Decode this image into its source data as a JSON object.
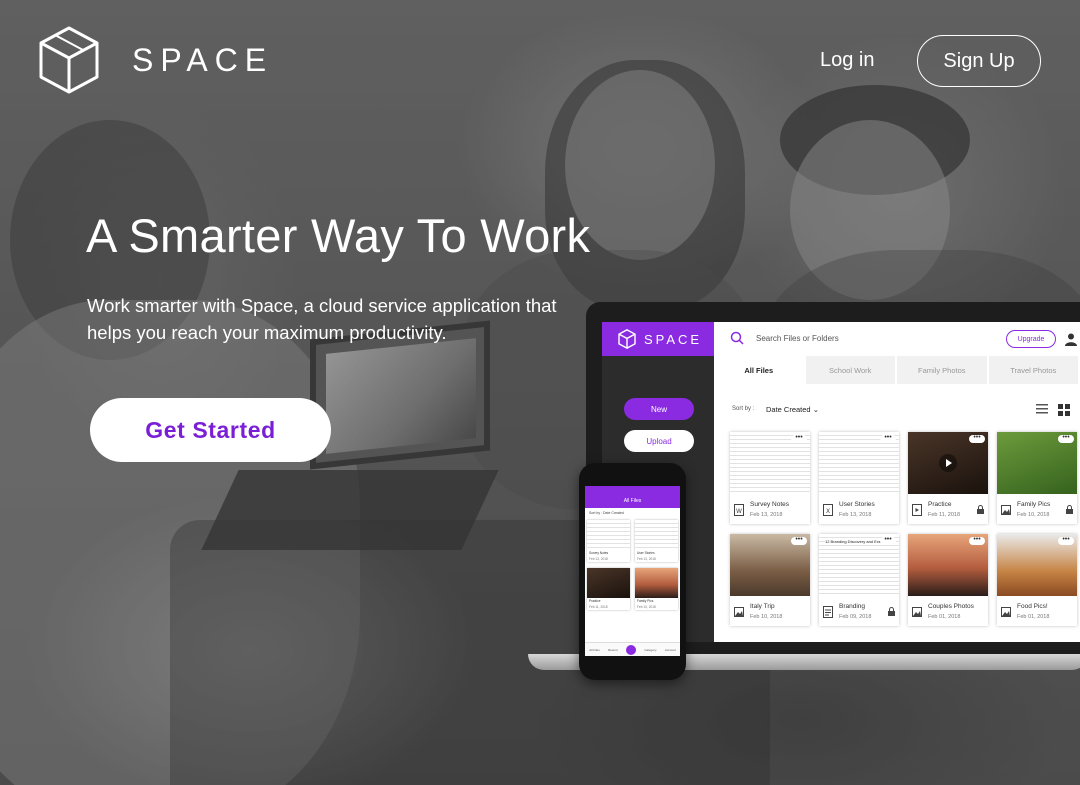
{
  "brand": {
    "name": "SPACE"
  },
  "nav": {
    "login_label": "Log in",
    "signup_label": "Sign Up"
  },
  "hero": {
    "title": "A Smarter Way To Work",
    "subtitle": "Work smarter with Space, a cloud service application that helps you reach your maximum productivity.",
    "cta_label": "Get Started"
  },
  "colors": {
    "accent": "#7a1fd6",
    "app_purple": "#8a2be2"
  },
  "app": {
    "brand": "SPACE",
    "search_placeholder": "Search Files or Folders",
    "upgrade_label": "Upgrade",
    "new_label": "New",
    "upload_label": "Upload",
    "tabs": [
      "All Files",
      "School Work",
      "Family Photos",
      "Travel Photos"
    ],
    "sort_label": "Sort by :",
    "sort_value": "Date Created",
    "files": [
      {
        "name": "Survey Notes",
        "date": "Feb 13, 2018",
        "kind": "doc",
        "locked": false
      },
      {
        "name": "User Stories",
        "date": "Feb 13, 2018",
        "kind": "doc",
        "locked": false
      },
      {
        "name": "Practice",
        "date": "Feb 11, 2018",
        "kind": "video",
        "locked": true
      },
      {
        "name": "Family Pics",
        "date": "Feb 10, 2018",
        "kind": "image",
        "locked": true
      },
      {
        "name": "Italy Trip",
        "date": "Feb 10, 2018",
        "kind": "image",
        "locked": false
      },
      {
        "name": "Branding",
        "date": "Feb 09, 2018",
        "kind": "doc",
        "locked": true
      },
      {
        "name": "Couples Photos",
        "date": "Feb 01, 2018",
        "kind": "image",
        "locked": false
      },
      {
        "name": "Food Pics!",
        "date": "Feb 01, 2018",
        "kind": "image",
        "locked": false
      }
    ],
    "branding_doc_heading": "12 Branding Discovery and Exe"
  },
  "phone": {
    "title": "All Files",
    "sort_label": "Sort by :",
    "sort_value": "Date Created",
    "files": [
      {
        "name": "Survey Notes",
        "date": "Feb 13, 2018"
      },
      {
        "name": "User Stories",
        "date": "Feb 13, 2018"
      },
      {
        "name": "Practice",
        "date": "Feb 11, 2018"
      },
      {
        "name": "Family Pics",
        "date": "Feb 10, 2018"
      }
    ],
    "nav": [
      "All Files",
      "Recent",
      "Category",
      "Account"
    ]
  }
}
